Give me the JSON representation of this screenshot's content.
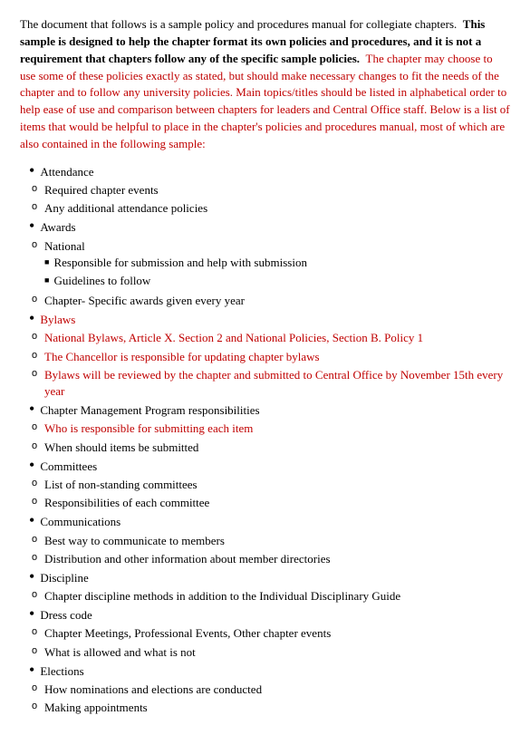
{
  "intro": {
    "part1": "The document that follows is a sample policy and procedures manual for collegiate chapters.",
    "part2": "This sample is designed to help the chapter format its own policies and procedures, and it is not a requirement that chapters follow any of the specific sample policies.",
    "part3": "The chapter may choose to use some of these policies exactly as stated, but should make necessary changes to fit the needs of the chapter and to follow any university policies. Main topics/titles should be listed in alphabetical order to help ease of use and comparison between chapters for leaders and Central Office staff. Below is a list of items that would be helpful to place in the chapter's policies and procedures manual, most of which are also contained in the following sample:"
  },
  "items": [
    {
      "label": "Attendance",
      "children": [
        {
          "label": "Required chapter events"
        },
        {
          "label": "Any additional attendance policies"
        }
      ]
    },
    {
      "label": "Awards",
      "children": [
        {
          "label": "National",
          "children": [
            {
              "label": "Responsible for submission and help with submission"
            },
            {
              "label": "Guidelines to follow"
            }
          ]
        },
        {
          "label": "Chapter- Specific awards given every year"
        }
      ]
    },
    {
      "label": "Bylaws",
      "red": true,
      "children": [
        {
          "label": "National Bylaws, Article X. Section 2 and National Policies, Section B. Policy 1",
          "red": true
        },
        {
          "label": "The Chancellor is responsible for updating chapter bylaws",
          "red": true
        },
        {
          "label": "Bylaws will be reviewed by the chapter and submitted to Central Office by November 15th every year",
          "red": true
        }
      ]
    },
    {
      "label": "Chapter Management Program responsibilities",
      "children": [
        {
          "label": "Who is responsible for submitting each item",
          "red": true
        },
        {
          "label": "When should items be submitted"
        }
      ]
    },
    {
      "label": "Committees",
      "children": [
        {
          "label": "List of non-standing committees"
        },
        {
          "label": "Responsibilities of each committee"
        }
      ]
    },
    {
      "label": "Communications",
      "children": [
        {
          "label": "Best way to communicate to members"
        },
        {
          "label": "Distribution and other information about member directories"
        }
      ]
    },
    {
      "label": "Discipline",
      "children": [
        {
          "label": "Chapter discipline methods in addition to the Individual Disciplinary Guide"
        }
      ]
    },
    {
      "label": "Dress code",
      "children": [
        {
          "label": "Chapter Meetings, Professional Events, Other chapter events"
        },
        {
          "label": "What is allowed and what is not"
        }
      ]
    },
    {
      "label": "Elections",
      "children": [
        {
          "label": "How nominations and elections are conducted"
        },
        {
          "label": "Making appointments"
        }
      ]
    }
  ]
}
